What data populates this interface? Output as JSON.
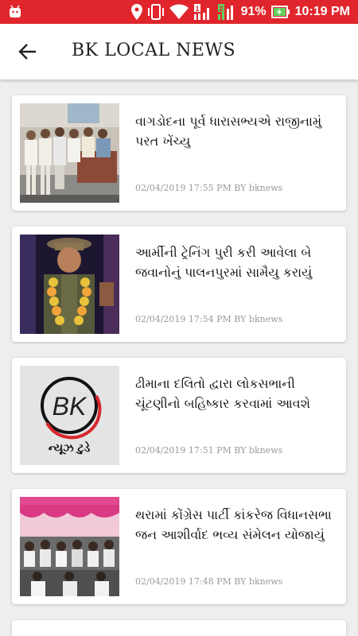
{
  "status": {
    "battery_percent": "91%",
    "time": "10:19 PM",
    "sim1_label": "1",
    "sim2_label": "2",
    "icons": [
      "android-icon",
      "location-icon",
      "vibrate-icon",
      "wifi-icon",
      "signal-icon",
      "battery-charging-icon"
    ]
  },
  "app_bar": {
    "title": "BK LOCAL NEWS",
    "back_icon": "arrow-left-icon"
  },
  "articles": [
    {
      "headline": "વાગડોદના પૂર્વ ધારાસભ્યએ રાજીનામું પરત ખેંચ્યુ",
      "meta": "02/04/2019 17:55 PM BY bknews",
      "thumb": "group-photo"
    },
    {
      "headline": "આર્મીની ટ્રેનિંગ પુરી કરી આવેલા બે જવાનોનું પાલનપુરમાં સામૈયુ કરાયું",
      "meta": "02/04/2019 17:54 PM BY bknews",
      "thumb": "soldier-garland-photo"
    },
    {
      "headline": "ઢીમાના દલિતો દ્વારા લોકસભાની ચૂંટણીનો બહિષ્કાર કરવામાં આવશે",
      "meta": "02/04/2019 17:51 PM BY bknews",
      "thumb": "bk-news-today-logo",
      "logo_text": "BK",
      "logo_caption": "ન્યૂઝ ટુડે"
    },
    {
      "headline": "થરામાં કોંગ્રેસ પાર્ટી કાંકરેજ વિધાનસભા જન આશીર્વાદ ભવ્ય સંમેલન યોજાયું",
      "meta": "02/04/2019 17:48 PM BY bknews",
      "thumb": "rally-tent-photo"
    }
  ],
  "colors": {
    "status_bar": "#e0262c",
    "background": "#eeeeee",
    "card": "#ffffff",
    "meta_text": "#9a9a9a"
  }
}
